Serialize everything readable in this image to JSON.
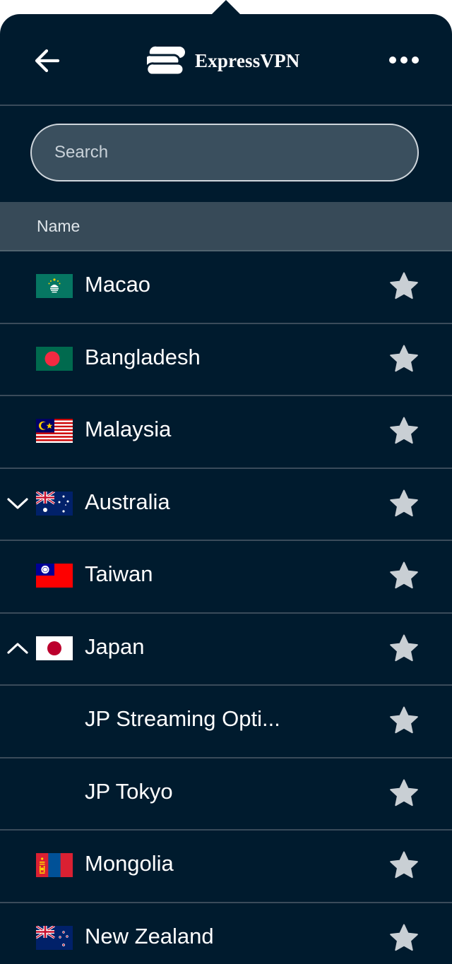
{
  "header": {
    "brand_name": "ExpressVPN",
    "back_icon": "arrow-left-icon",
    "more_icon": "more-horizontal-icon"
  },
  "search": {
    "placeholder": "Search",
    "value": ""
  },
  "table": {
    "column_header": "Name"
  },
  "locations": [
    {
      "label": "Macao",
      "flag": "macao-flag-icon",
      "chevron": null,
      "favorite": false
    },
    {
      "label": "Bangladesh",
      "flag": "bangladesh-flag-icon",
      "chevron": null,
      "favorite": false
    },
    {
      "label": "Malaysia",
      "flag": "malaysia-flag-icon",
      "chevron": null,
      "favorite": false
    },
    {
      "label": "Australia",
      "flag": "australia-flag-icon",
      "chevron": "chevron-down-icon",
      "favorite": false
    },
    {
      "label": "Taiwan",
      "flag": "taiwan-flag-icon",
      "chevron": null,
      "favorite": false
    },
    {
      "label": "Japan",
      "flag": "japan-flag-icon",
      "chevron": "chevron-up-icon",
      "favorite": false
    },
    {
      "label": "JP Streaming Opti...",
      "flag": null,
      "chevron": null,
      "favorite": false
    },
    {
      "label": "JP Tokyo",
      "flag": null,
      "chevron": null,
      "favorite": false
    },
    {
      "label": "Mongolia",
      "flag": "mongolia-flag-icon",
      "chevron": null,
      "favorite": false
    },
    {
      "label": "New Zealand",
      "flag": "new-zealand-flag-icon",
      "chevron": null,
      "favorite": false
    }
  ],
  "colors": {
    "background": "#001b2e",
    "divider": "#3a4b5a",
    "header_bar": "#374a58",
    "search_fill": "#3a4f5e",
    "star": "#c9cfd4"
  }
}
